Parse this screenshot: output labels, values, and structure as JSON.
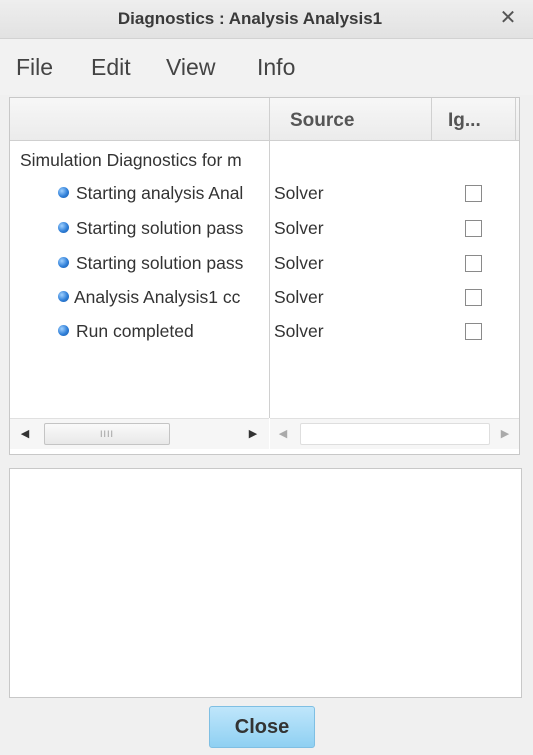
{
  "window": {
    "title": "Diagnostics : Analysis Analysis1",
    "close_glyph": "✕"
  },
  "menu": [
    "File",
    "Edit",
    "View",
    "Info"
  ],
  "table": {
    "columns": [
      "",
      "Source",
      "Ig..."
    ],
    "group_label": "Simulation Diagnostics for m",
    "rows": [
      {
        "message": "Starting analysis Anal",
        "source": "Solver",
        "ignored": false,
        "icon": "info-bullet-icon"
      },
      {
        "message": "Starting solution pass",
        "source": "Solver",
        "ignored": false,
        "icon": "info-bullet-icon"
      },
      {
        "message": "Starting solution pass",
        "source": "Solver",
        "ignored": false,
        "icon": "info-bullet-icon"
      },
      {
        "message": "Analysis Analysis1 cc",
        "source": "Solver",
        "ignored": false,
        "icon": "info-bullet-icon"
      },
      {
        "message": "Run completed",
        "source": "Solver",
        "ignored": false,
        "icon": "info-bullet-icon"
      }
    ],
    "scroll_thumb_grip": "IIII"
  },
  "detail_text": "",
  "buttons": {
    "close": "Close"
  },
  "colors": {
    "accent_button": "#8fd0f2",
    "bullet": "#2f7fd8"
  }
}
